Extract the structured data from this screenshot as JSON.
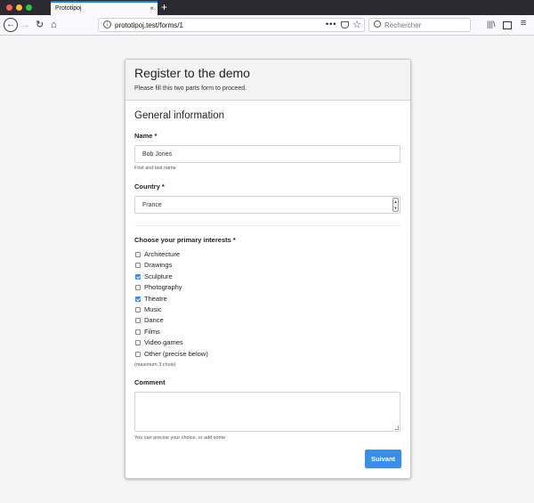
{
  "browser": {
    "tab_title": "Prototipoj",
    "tab_close": "×",
    "new_tab": "+",
    "url": "prototipoj.test/forms/1",
    "page_actions": "•••",
    "search_placeholder": "Rechercher",
    "icons": [
      "back-icon",
      "forward-icon",
      "reload-icon",
      "home-icon",
      "info-icon",
      "pocket-icon",
      "bookmark-star-icon",
      "search-icon",
      "library-icon",
      "sidebar-icon",
      "menu-icon"
    ]
  },
  "form": {
    "title": "Register to the demo",
    "subtitle": "Please fill this two parts form to proceed.",
    "section_title": "General information",
    "name": {
      "label": "Name *",
      "value": "Bob Jones",
      "help": "First and last name"
    },
    "country": {
      "label": "Country *",
      "selected": "France"
    },
    "interests": {
      "label": "Choose your primary interests *",
      "options": [
        {
          "label": "Architecture",
          "checked": false
        },
        {
          "label": "Drawings",
          "checked": false
        },
        {
          "label": "Sculpture",
          "checked": true
        },
        {
          "label": "Photography",
          "checked": false
        },
        {
          "label": "Theatre",
          "checked": true
        },
        {
          "label": "Music",
          "checked": false
        },
        {
          "label": "Dance",
          "checked": false
        },
        {
          "label": "Films",
          "checked": false
        },
        {
          "label": "Video games",
          "checked": false
        },
        {
          "label": "Other (precise below)",
          "checked": false
        }
      ],
      "help": "(maximum 3 choix)"
    },
    "comment": {
      "label": "Comment",
      "value": "",
      "help": "You can precise your choice, or add some"
    },
    "submit_label": "Suivant"
  },
  "colors": {
    "accent": "#3b8ee8",
    "tab_indicator": "#0a84ff",
    "titlebar": "#2b2a33"
  }
}
